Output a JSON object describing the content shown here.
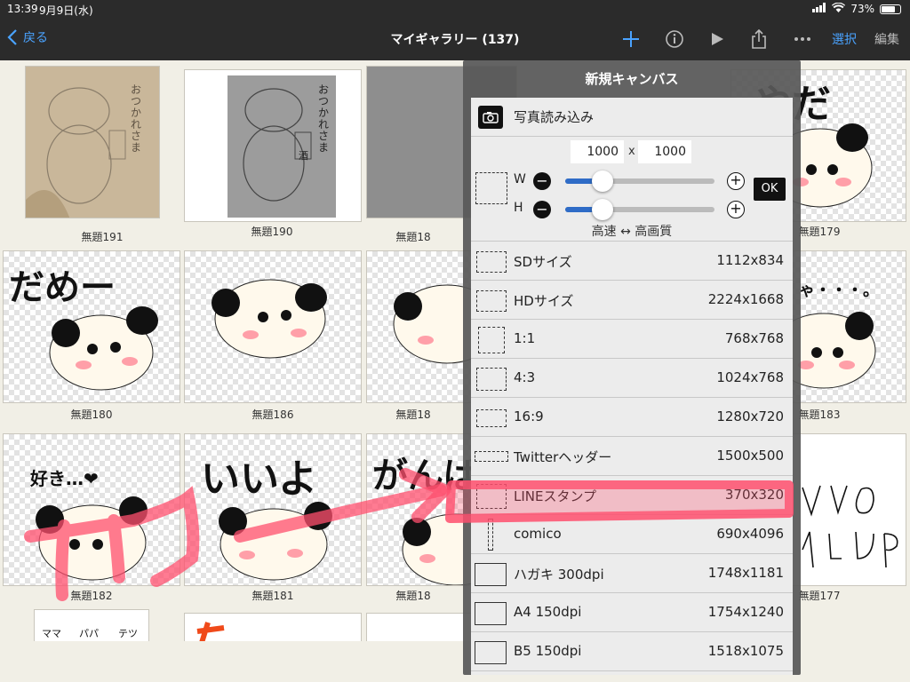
{
  "status": {
    "time": "13:39",
    "date": "9月9日(水)",
    "battery": "73%",
    "battery_level": 0.73
  },
  "nav": {
    "back": "戻る",
    "title": "マイギャラリー (137)",
    "select": "選択",
    "edit": "編集"
  },
  "gallery": {
    "captions": [
      "無題191",
      "無題190",
      "無題18",
      "無題179",
      "無題180",
      "無題186",
      "無題18",
      "無題183",
      "無題182",
      "無題181",
      "無題18",
      "無題177"
    ]
  },
  "art_text": {
    "greeting_1": "おつかれさま",
    "label": "酒",
    "yada": "やだ",
    "dame": "だめー",
    "suki": "好き…❤",
    "iiyo": "いいよ",
    "ganba": "がんば",
    "hmm": "ゃ・・・。",
    "bottom_1": "ママ",
    "bottom_2": "パパ",
    "bottom_3": "テツ"
  },
  "popover": {
    "title": "新規キャンバス",
    "import": "写真読み込み",
    "width_value": "1000",
    "height_value": "1000",
    "times": "x",
    "w_label": "W",
    "h_label": "H",
    "ok": "OK",
    "quality": "高速 ↔ 高画質",
    "w_slider": 0.25,
    "h_slider": 0.25,
    "presets": [
      {
        "name": "SDサイズ",
        "size": "1112x834"
      },
      {
        "name": "HDサイズ",
        "size": "2224x1668"
      },
      {
        "name": "1:1",
        "size": "768x768"
      },
      {
        "name": "4:3",
        "size": "1024x768"
      },
      {
        "name": "16:9",
        "size": "1280x720"
      },
      {
        "name": "Twitterヘッダー",
        "size": "1500x500"
      },
      {
        "name": "LINEスタンプ",
        "size": "370x320"
      },
      {
        "name": "comico",
        "size": "690x4096"
      },
      {
        "name": "ハガキ 300dpi",
        "size": "1748x1181"
      },
      {
        "name": "A4 150dpi",
        "size": "1754x1240"
      },
      {
        "name": "B5 150dpi",
        "size": "1518x1075"
      }
    ]
  },
  "colors": {
    "accent": "#4aa3ff",
    "slider": "#2f6cc7",
    "highlight": "#ff4f6e",
    "bar": "#2b2b2b"
  }
}
